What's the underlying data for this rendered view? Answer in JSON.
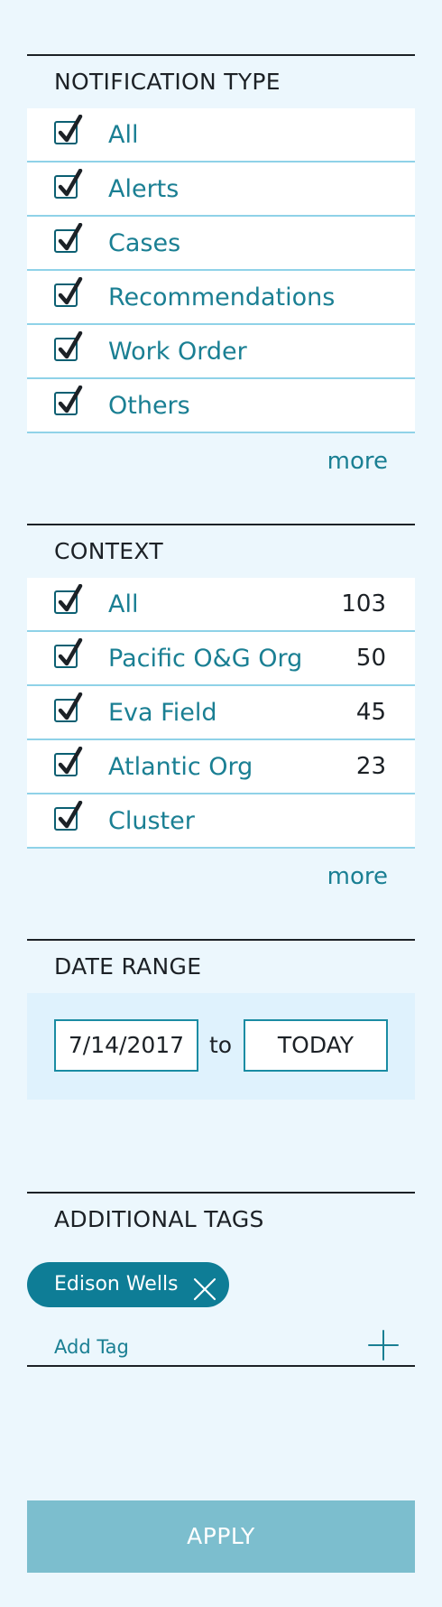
{
  "notification_type": {
    "title": "NOTIFICATION TYPE",
    "items": [
      {
        "label": "All",
        "checked": true
      },
      {
        "label": "Alerts",
        "checked": true
      },
      {
        "label": "Cases",
        "checked": true
      },
      {
        "label": "Recommendations",
        "checked": true
      },
      {
        "label": "Work Order",
        "checked": true
      },
      {
        "label": "Others",
        "checked": true
      }
    ],
    "more_label": "more"
  },
  "context": {
    "title": "CONTEXT",
    "items": [
      {
        "label": "All",
        "count": "103",
        "checked": true
      },
      {
        "label": "Pacific O&G Org",
        "count": "50",
        "checked": true
      },
      {
        "label": "Eva Field",
        "count": "45",
        "checked": true
      },
      {
        "label": "Atlantic Org",
        "count": "23",
        "checked": true
      },
      {
        "label": "Cluster",
        "count": "",
        "checked": true
      }
    ],
    "more_label": "more"
  },
  "date_range": {
    "title": "DATE RANGE",
    "from": "7/14/2017",
    "separator": "to",
    "to": "TODAY"
  },
  "additional_tags": {
    "title": "ADDITIONAL TAGS",
    "tags": [
      {
        "label": "Edison Wells"
      }
    ],
    "add_label": "Add Tag"
  },
  "apply_label": "APPLY",
  "colors": {
    "background": "#ecf7fd",
    "accent": "#1a7f93",
    "chip": "#0e7d96",
    "apply": "#7cbece"
  }
}
